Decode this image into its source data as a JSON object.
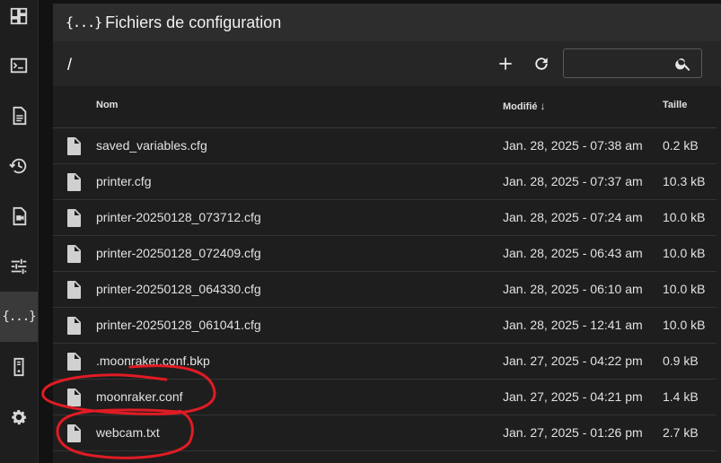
{
  "nav": {
    "items": [
      {
        "icon": "dashboard-icon"
      },
      {
        "icon": "console-icon"
      },
      {
        "icon": "gcode-file-icon"
      },
      {
        "icon": "history-icon"
      },
      {
        "icon": "timelapse-icon"
      },
      {
        "icon": "tune-icon"
      },
      {
        "icon": "config-braces-icon",
        "label": "{...}",
        "active": true
      },
      {
        "icon": "machine-icon"
      },
      {
        "icon": "gear-icon"
      }
    ]
  },
  "header": {
    "icon_text": "{...}",
    "title": "Fichiers de configuration"
  },
  "toolbar": {
    "path": "/",
    "search_placeholder": ""
  },
  "table": {
    "headers": {
      "name": "Nom",
      "modified": "Modifié",
      "sort_indicator": "↓",
      "size": "Taille"
    },
    "rows": [
      {
        "name": "saved_variables.cfg",
        "modified": "Jan. 28, 2025 - 07:38 am",
        "size": "0.2 kB"
      },
      {
        "name": "printer.cfg",
        "modified": "Jan. 28, 2025 - 07:37 am",
        "size": "10.3 kB"
      },
      {
        "name": "printer-20250128_073712.cfg",
        "modified": "Jan. 28, 2025 - 07:24 am",
        "size": "10.0 kB"
      },
      {
        "name": "printer-20250128_072409.cfg",
        "modified": "Jan. 28, 2025 - 06:43 am",
        "size": "10.0 kB"
      },
      {
        "name": "printer-20250128_064330.cfg",
        "modified": "Jan. 28, 2025 - 06:10 am",
        "size": "10.0 kB"
      },
      {
        "name": "printer-20250128_061041.cfg",
        "modified": "Jan. 28, 2025 - 12:41 am",
        "size": "10.0 kB"
      },
      {
        "name": ".moonraker.conf.bkp",
        "modified": "Jan. 27, 2025 - 04:22 pm",
        "size": "0.9 kB"
      },
      {
        "name": "moonraker.conf",
        "modified": "Jan. 27, 2025 - 04:21 pm",
        "size": "1.4 kB"
      },
      {
        "name": "webcam.txt",
        "modified": "Jan. 27, 2025 - 01:26 pm",
        "size": "2.7 kB"
      }
    ]
  },
  "annotation_color": "#e01b24"
}
